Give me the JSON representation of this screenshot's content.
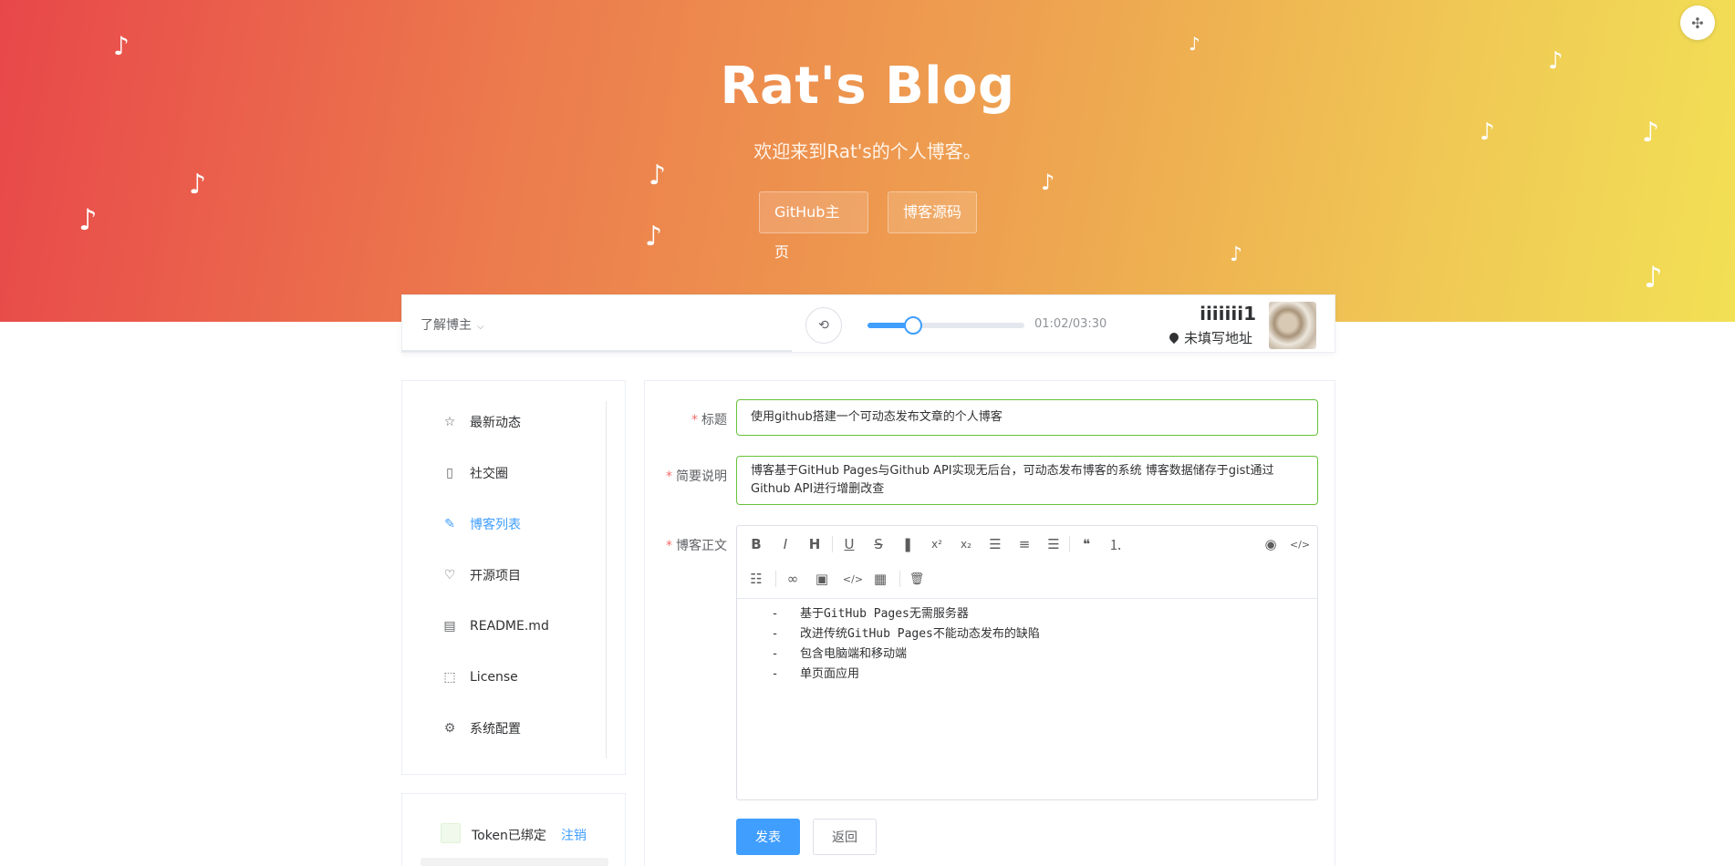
{
  "hero": {
    "title": "Rat's Blog",
    "subtitle": "欢迎来到Rat's的个人博客。",
    "buttons": [
      "GitHub主页",
      "博客源码"
    ],
    "note_glyph": "♪",
    "gradient_colors": [
      "#e8474a",
      "#ec7b4d",
      "#eea550",
      "#f0cc55",
      "#f2e055"
    ],
    "corner_icon": "move-icon"
  },
  "header": {
    "about_label": "了解博主",
    "about_chevron": "⌵",
    "player": {
      "loop_icon": "⟲",
      "progress": 0.29,
      "time": "01:02/03:30"
    },
    "user": {
      "name": "iiiiiii1",
      "location": "未填写地址"
    }
  },
  "nav": {
    "items": [
      {
        "label": "最新动态",
        "icon": "☆",
        "icon_name": "star-icon"
      },
      {
        "label": "社交圈",
        "icon": "▯",
        "icon_name": "tablet-icon"
      },
      {
        "label": "博客列表",
        "icon": "✎",
        "icon_name": "edit-icon",
        "active": true
      },
      {
        "label": "开源项目",
        "icon": "♡",
        "icon_name": "headset-icon"
      },
      {
        "label": "README.md",
        "icon": "▤",
        "icon_name": "document-icon"
      },
      {
        "label": "License",
        "icon": "⬚",
        "icon_name": "license-icon"
      },
      {
        "label": "系统配置",
        "icon": "⚙",
        "icon_name": "settings-icon"
      }
    ],
    "active_color": "#409eff"
  },
  "token": {
    "text": "Token已绑定",
    "logout": "注销"
  },
  "form": {
    "title_label": "标题",
    "title_value": "使用github搭建一个可动态发布文章的个人博客",
    "desc_label": "简要说明",
    "desc_value": "博客基于GitHub Pages与Github API实现无后台，可动态发布博客的系统 博客数据储存于gist通过Github API进行增删改查",
    "body_label": "博客正文",
    "body_lines": [
      "  -   基于GitHub Pages无需服务器",
      "  -   改进传统GitHub Pages不能动态发布的缺陷",
      "  -   包含电脑端和移动端",
      "  -   单页面应用"
    ],
    "toolbar_row1": [
      {
        "glyph": "B",
        "name": "bold-icon"
      },
      {
        "glyph": "I",
        "name": "italic-icon"
      },
      {
        "glyph": "H",
        "name": "heading-icon"
      },
      {
        "glyph": "U",
        "name": "underline-icon"
      },
      {
        "glyph": "S",
        "name": "strikethrough-icon"
      },
      {
        "glyph": "❚",
        "name": "bookmark-icon"
      },
      {
        "glyph": "x²",
        "name": "superscript-icon"
      },
      {
        "glyph": "x₂",
        "name": "subscript-icon"
      },
      {
        "glyph": "☰",
        "name": "align-left-icon"
      },
      {
        "glyph": "≡",
        "name": "align-center-icon"
      },
      {
        "glyph": "☰",
        "name": "align-right-icon"
      },
      {
        "glyph": "❝",
        "name": "quote-icon"
      },
      {
        "glyph": "⒈",
        "name": "ordered-list-icon"
      }
    ],
    "toolbar_row1_right": [
      {
        "glyph": "◉",
        "name": "preview-icon"
      },
      {
        "glyph": "</>",
        "name": "source-icon"
      }
    ],
    "toolbar_row2": [
      {
        "glyph": "☷",
        "name": "unordered-list-icon"
      },
      {
        "glyph": "∞",
        "name": "link-icon"
      },
      {
        "glyph": "▣",
        "name": "image-icon"
      },
      {
        "glyph": "</>",
        "name": "code-icon"
      },
      {
        "glyph": "▦",
        "name": "table-icon"
      },
      {
        "glyph": "🗑",
        "name": "trash-icon"
      }
    ],
    "submit": "发表",
    "back": "返回",
    "valid_color": "#67c23a",
    "required_color": "#f56c6c"
  }
}
